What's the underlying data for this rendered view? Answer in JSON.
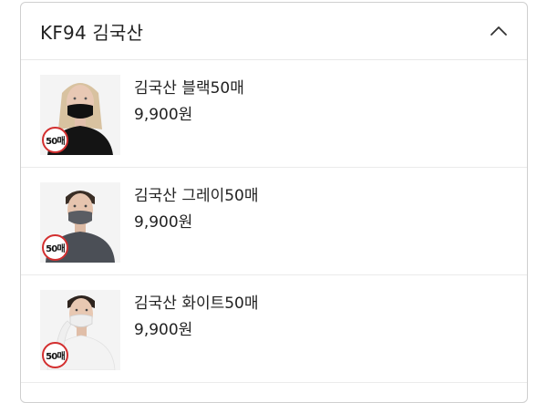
{
  "section": {
    "title": "KF94 김국산",
    "toggle_icon": "chevron-up-icon"
  },
  "badge_color": "#d32f2f",
  "products": [
    {
      "name": "김국산 블랙50매",
      "price": "9,900원",
      "badge": "50매",
      "mask_color": "#111111",
      "shirt_color": "#141414",
      "hair_color": "#d8c2a0"
    },
    {
      "name": "김국산 그레이50매",
      "price": "9,900원",
      "badge": "50매",
      "mask_color": "#5a5d63",
      "shirt_color": "#4b4f56",
      "hair_color": "#3a2e26"
    },
    {
      "name": "김국산 화이트50매",
      "price": "9,900원",
      "badge": "50매",
      "mask_color": "#eeeeee",
      "shirt_color": "#f3f3f3",
      "hair_color": "#2e241e"
    }
  ]
}
